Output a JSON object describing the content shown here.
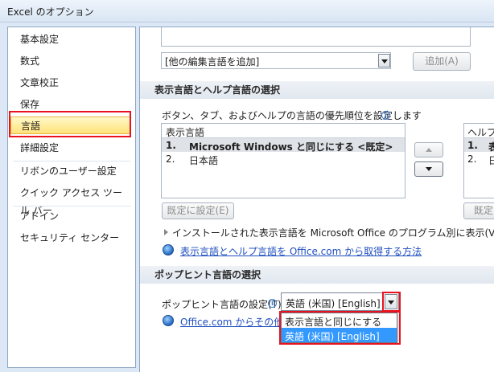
{
  "window": {
    "title": "Excel のオプション"
  },
  "nav": {
    "items": [
      {
        "label": "基本設定"
      },
      {
        "label": "数式"
      },
      {
        "label": "文章校正"
      },
      {
        "label": "保存"
      },
      {
        "label": "言語"
      },
      {
        "label": "詳細設定"
      },
      {
        "label": "リボンのユーザー設定"
      },
      {
        "label": "クイック アクセス ツール バー"
      },
      {
        "label": "アドイン"
      },
      {
        "label": "セキュリティ センター"
      }
    ],
    "selected": "言語"
  },
  "editing": {
    "add_combo_value": "[他の編集言語を追加]",
    "add_button": "追加(A)"
  },
  "display": {
    "section_title": "表示言語とヘルプ言語の選択",
    "description": "ボタン、タブ、およびヘルプの言語の優先順位を設定します",
    "display_list": {
      "header": "表示言語",
      "rows": [
        {
          "num": "1.",
          "text": "Microsoft Windows と同じにする <既定>"
        },
        {
          "num": "2.",
          "text": "日本語"
        }
      ]
    },
    "help_list": {
      "header": "ヘルプ",
      "rows": [
        {
          "num": "1.",
          "text": "表"
        },
        {
          "num": "2.",
          "text": "日"
        }
      ]
    },
    "set_default_button": "既定に設定(E)",
    "set_default_button_2": "既定",
    "installed_toggle": "インストールされた表示言語を Microsoft Office のプログラム別に表示(V)",
    "get_languages_link": "表示言語とヘルプ言語を Office.com から取得する方法"
  },
  "screentip": {
    "section_title": "ポップヒント言語の選択",
    "setting_label": "ポップヒント言語の設定(T)",
    "selected_value": "英語 (米国) [English]",
    "options": [
      {
        "label": "表示言語と同じにする"
      },
      {
        "label": "英語 (米国) [English]"
      }
    ],
    "link_text": "Office.com からその他の"
  }
}
